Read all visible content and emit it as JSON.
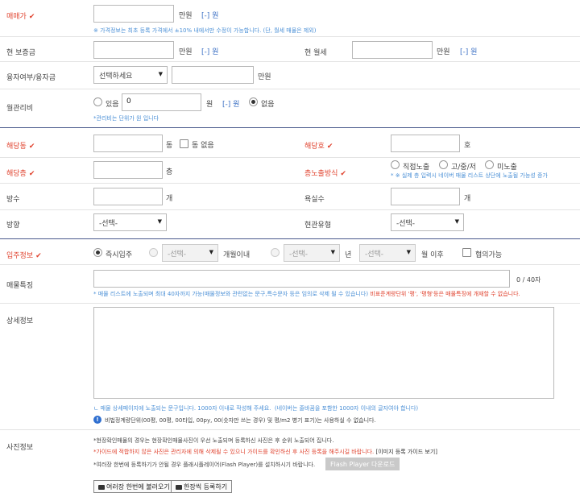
{
  "price": {
    "label": "매매가",
    "check": "✔",
    "unit": "만원",
    "won_link": "[-] 원",
    "note": "※ 가격정보는 최초 등록 가격에서 ±10% 내에서만 수정이 가능합니다. (단, 월세 매물은 제외)"
  },
  "deposit": {
    "label": "현 보증금",
    "unit": "만원",
    "won_link": "[-] 원"
  },
  "monthly": {
    "label": "현 월세",
    "unit": "만원",
    "won_link": "[-] 원"
  },
  "loan": {
    "label": "융자여부/융자금",
    "select": "선택하세요",
    "unit": "만원"
  },
  "maint": {
    "label": "월관리비",
    "opt_yes": "있음",
    "value": "0",
    "unit": "원",
    "won_link": "[-] 원",
    "opt_no": "없음",
    "note": "*관리비는 단위가 원 입니다"
  },
  "dong": {
    "label": "해당동",
    "check": "✔",
    "unit": "동",
    "no_dong": "동 없음"
  },
  "ho": {
    "label": "해당호",
    "check": "✔",
    "unit": "호"
  },
  "floor": {
    "label": "해당층",
    "check": "✔",
    "unit": "층"
  },
  "exposure": {
    "label": "층노출방식",
    "check": "✔",
    "opt1": "직접노출",
    "opt2": "고/중/저",
    "opt3": "미노출",
    "note": "* ※ 실제 층 입력시 네이버 매물 리스트 상단에 노출될 가능성 증가"
  },
  "rooms": {
    "label": "방수",
    "unit": "개"
  },
  "baths": {
    "label": "욕실수",
    "unit": "개"
  },
  "direction": {
    "label": "방향",
    "select": "-선택-"
  },
  "entrance": {
    "label": "현관유형",
    "select": "-선택-"
  },
  "movein": {
    "label": "입주정보",
    "check": "✔",
    "opt_now": "즉시입주",
    "months_select": "-선택-",
    "months_unit": "개월이내",
    "year_select": "-선택-",
    "year_unit": "년",
    "month_select": "-선택-",
    "month_unit": "월 이후",
    "negotiable": "협의가능"
  },
  "feature": {
    "label": "매물특징",
    "counter": "0 / 40자",
    "note_a": "* 매물 리스트에 노출되며 최대 40자까지 가능(매물정보와 관련없는 문구,특수문자 등은 임의로 삭제 될 수 있습니다)",
    "note_b": "비표준계량단위 '평', '평형'등은 매물특징에 개재할 수 없습니다."
  },
  "detail": {
    "label": "상세정보",
    "note_a": "ㄴ 매물 상세페이지에 노출되는 문구입니다. 1000자 이내로 작성해 주세요.",
    "note_b": "(네이버는 줄바꿈을 포함한 1000자 이내의 글자여야 합니다)",
    "info": "비법정계량단위(00평, 00평, 00타입, 00py, 00(숫자만 쓰는 경우) 및 평/m2 병기 표기)는 사용하실 수 없습니다."
  },
  "photo": {
    "label": "사진정보",
    "line1": "*현장확인매물의 경우는 현장확인매물사진이 우선 노출되며 등록하신 사진은 후 순위 노출되어 집니다.",
    "line2": "*가이드에 적합하지 않은 사진은 관리자에 의해 삭제될 수 있으니 가이드를 확인하신 후 사진 등록을 해주시길 바랍니다.",
    "guide_link": "[이미지 등록 가이드 보기]",
    "line3": "*여러장 한번에 등록하기가 안될 경우 플래시플레이어(Flash Player)를 설치하시기 바랍니다.",
    "flash_btn": "Flash Player 다운로드",
    "btn_multi": "여러장 한번에 불러오기",
    "btn_single": "한장씩 등록하기"
  }
}
